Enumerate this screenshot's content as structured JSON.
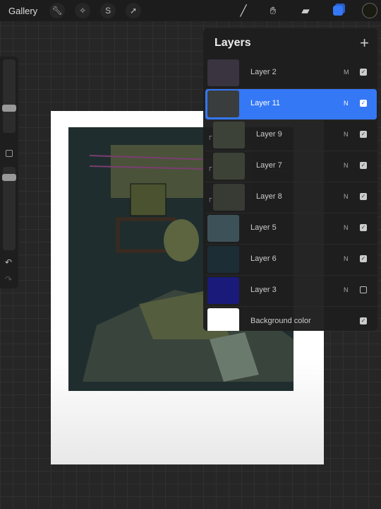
{
  "topbar": {
    "gallery": "Gallery",
    "left_tools": [
      "wrench-icon",
      "magic-wand-icon",
      "selection-icon",
      "move-arrow-icon"
    ],
    "right_tools": [
      "brush-icon",
      "smudge-icon",
      "eraser-icon",
      "layers-icon"
    ],
    "color_swatch": "#1a1c12",
    "accent": "#3478f6"
  },
  "layers": {
    "title": "Layers",
    "add": "+",
    "items": [
      {
        "name": "Layer 2",
        "mode": "M",
        "visible": true,
        "clipped": false,
        "selected": false,
        "thumb": "#3a3340"
      },
      {
        "name": "Layer 11",
        "mode": "N",
        "visible": true,
        "clipped": false,
        "selected": true,
        "thumb": "#3a3d3d"
      },
      {
        "name": "Layer 9",
        "mode": "N",
        "visible": true,
        "clipped": true,
        "selected": false,
        "thumb": "#3c4238"
      },
      {
        "name": "Layer 7",
        "mode": "N",
        "visible": true,
        "clipped": true,
        "selected": false,
        "thumb": "#3c4236"
      },
      {
        "name": "Layer 8",
        "mode": "N",
        "visible": true,
        "clipped": true,
        "selected": false,
        "thumb": "#383a34"
      },
      {
        "name": "Layer 5",
        "mode": "N",
        "visible": true,
        "clipped": false,
        "selected": false,
        "thumb": "#3d5258"
      },
      {
        "name": "Layer 6",
        "mode": "N",
        "visible": true,
        "clipped": false,
        "selected": false,
        "thumb": "#1c2d36"
      },
      {
        "name": "Layer 3",
        "mode": "N",
        "visible": false,
        "clipped": false,
        "selected": false,
        "thumb": "#1a1a7a"
      },
      {
        "name": "Background color",
        "mode": "",
        "visible": true,
        "clipped": false,
        "selected": false,
        "thumb": "#ffffff"
      }
    ]
  }
}
